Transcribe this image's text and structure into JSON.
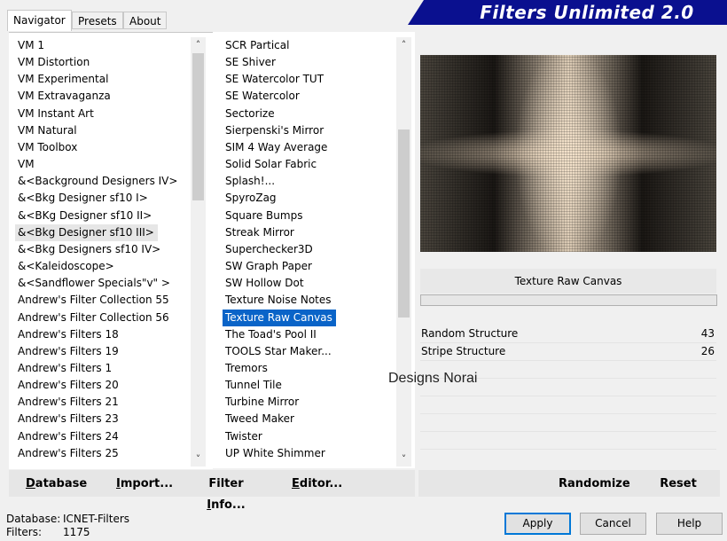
{
  "tabs": [
    "Navigator",
    "Presets",
    "About"
  ],
  "banner_title": "Filters Unlimited 2.0",
  "categories": [
    "VM 1",
    "VM Distortion",
    "VM Experimental",
    "VM Extravaganza",
    "VM Instant Art",
    "VM Natural",
    "VM Toolbox",
    "VM",
    "&<Background Designers IV>",
    "&<Bkg Designer sf10 I>",
    "&<BKg Designer sf10 II>",
    "&<Bkg Designer sf10 III>",
    "&<Bkg Designers sf10 IV>",
    "&<Kaleidoscope>",
    "&<Sandflower Specials\"v\" >",
    "Andrew's Filter Collection 55",
    "Andrew's Filter Collection 56",
    "Andrew's Filters 18",
    "Andrew's Filters 19",
    "Andrew's Filters 1",
    "Andrew's Filters 20",
    "Andrew's Filters 21",
    "Andrew's Filters 23",
    "Andrew's Filters 24",
    "Andrew's Filters 25"
  ],
  "filters": [
    "SCR  Partical",
    "SE Shiver",
    "SE Watercolor TUT",
    "SE Watercolor",
    "Sectorize",
    "Sierpenski's Mirror",
    "SIM 4 Way Average",
    "Solid Solar Fabric",
    "Splash!...",
    "SpyroZag",
    "Square Bumps",
    "Streak Mirror",
    "Superchecker3D",
    "SW Graph Paper",
    "SW Hollow Dot",
    "Texture Noise Notes",
    "Texture Raw Canvas",
    "The Toad's Pool II",
    "TOOLS Star Maker...",
    "Tremors",
    "Tunnel Tile",
    "Turbine Mirror",
    "Tweed Maker",
    "Twister",
    "UP White Shimmer"
  ],
  "selected_filter": "Texture Raw Canvas",
  "params": [
    {
      "label": "Random Structure",
      "value": "43"
    },
    {
      "label": "Stripe Structure",
      "value": "26"
    }
  ],
  "watermark": "Designs Norai",
  "buttons": {
    "database": {
      "u": "D",
      "rest": "atabase"
    },
    "import": {
      "u": "I",
      "rest": "mport..."
    },
    "filter_info": {
      "pre": "Filter ",
      "u": "I",
      "rest": "nfo..."
    },
    "editor": {
      "u": "E",
      "rest": "ditor..."
    },
    "randomize": "Randomize",
    "reset": "Reset",
    "apply": "Apply",
    "cancel": "Cancel",
    "help": "Help"
  },
  "status": {
    "database_label": "Database:",
    "database_value": "ICNET-Filters",
    "filters_label": "Filters:",
    "filters_value": "1175"
  },
  "colors": {
    "banner": "#0a108f",
    "selection": "#0a64c8",
    "default_button_border": "#0078d7"
  }
}
